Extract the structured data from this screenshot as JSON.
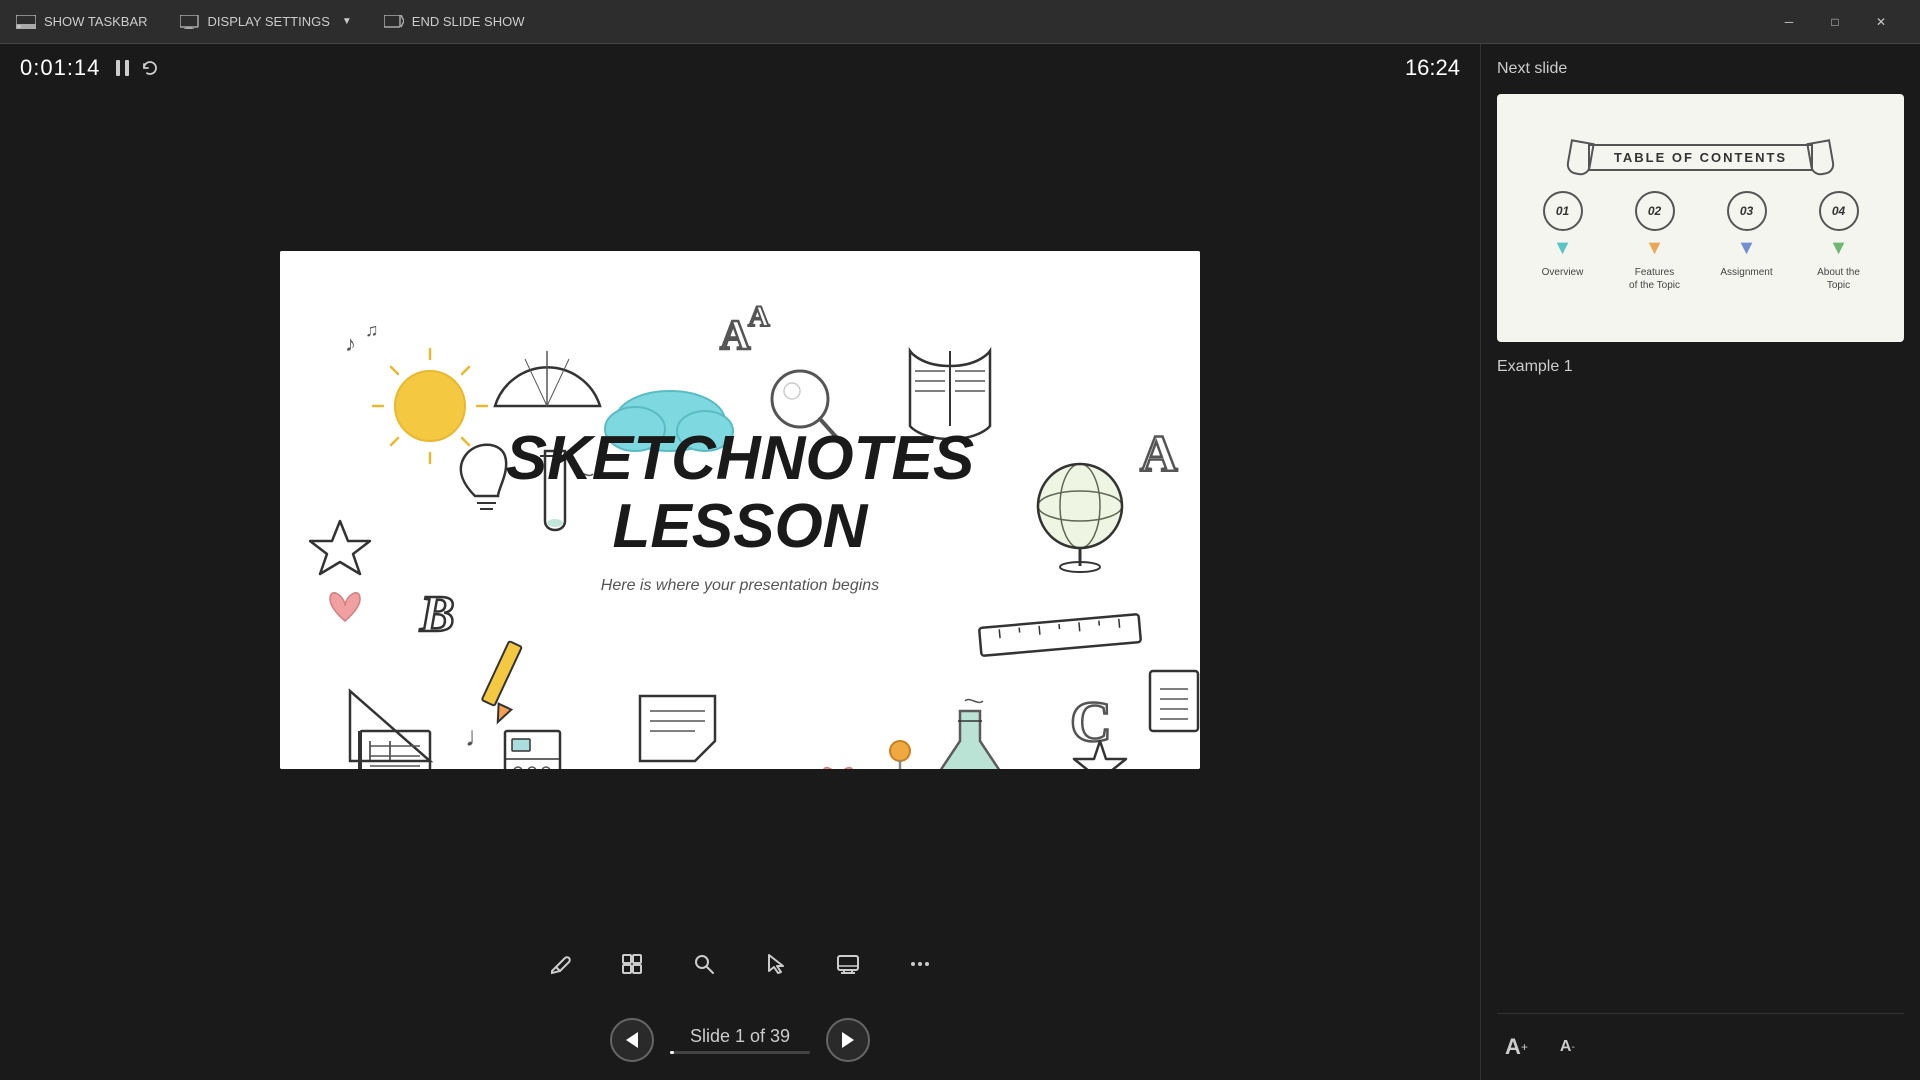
{
  "topbar": {
    "show_taskbar": "SHOW TASKBAR",
    "display_settings": "DISPLAY SETTINGS",
    "end_slideshow": "END SLIDE SHOW"
  },
  "timer": {
    "elapsed": "0:01:14",
    "clock": "16:24"
  },
  "slide": {
    "main_title_line1": "SKETCHNOTES",
    "main_title_line2": "LESSON",
    "subtitle": "Here is where your presentation begins",
    "current": 1,
    "total": 39,
    "indicator": "Slide 1 of 39"
  },
  "next_slide": {
    "label": "Next slide",
    "toc_title": "TABLE OF CONTENTS",
    "items": [
      {
        "num": "01",
        "label": "Overview"
      },
      {
        "num": "02",
        "label": "Features\nof the Topic"
      },
      {
        "num": "03",
        "label": "Assignment"
      },
      {
        "num": "04",
        "label": "About the\nTopic"
      }
    ]
  },
  "example": {
    "label": "Example 1"
  },
  "toolbar": {
    "pen": "✏",
    "grid": "⊞",
    "zoom": "🔍",
    "pointer": "⊹",
    "display": "▬",
    "more": "···"
  },
  "window": {
    "minimize": "─",
    "maximize": "□",
    "close": "✕"
  }
}
